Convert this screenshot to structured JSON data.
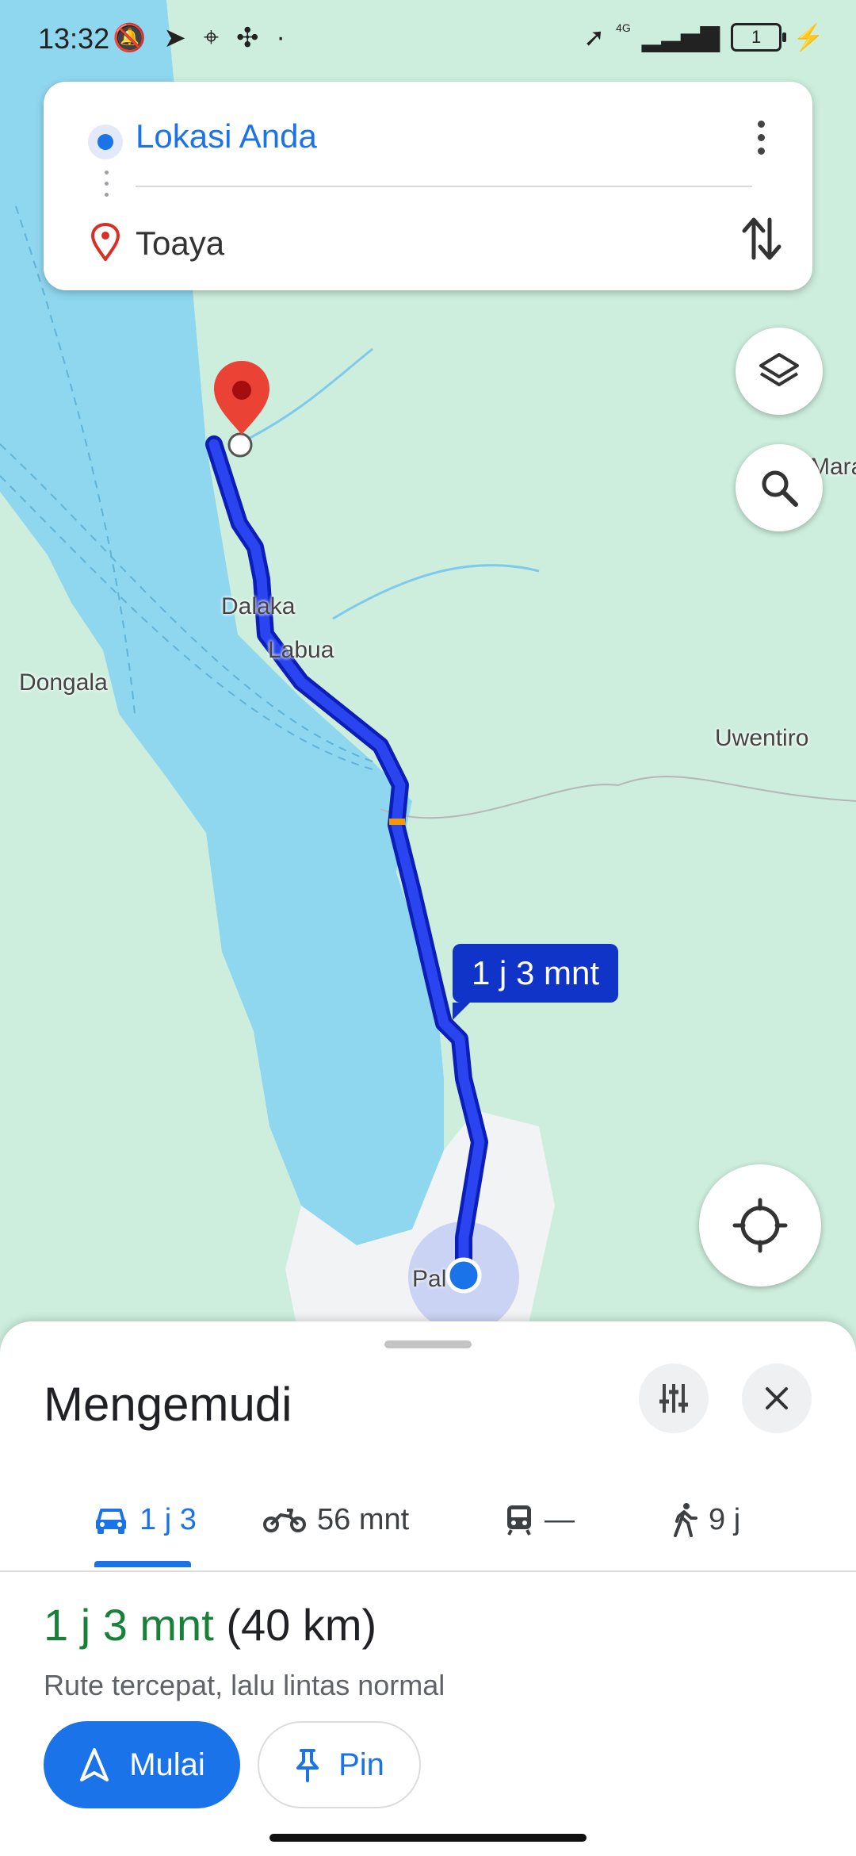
{
  "status_bar": {
    "time": "13:32",
    "network": "4G",
    "battery": "1"
  },
  "directions": {
    "origin": "Lokasi Anda",
    "destination": "Toaya"
  },
  "map": {
    "labels": {
      "mara": "Mara",
      "dalaka": "Dalaka",
      "labua": "Labua",
      "dongala": "Dongala",
      "uwentiro": "Uwentiro",
      "palu": "Pal"
    },
    "eta_bubble": "1 j 3 mnt",
    "colors": {
      "route": "#1a1aeb",
      "water": "#8fd7ef",
      "land": "#cdeedd"
    }
  },
  "sheet": {
    "title": "Mengemudi",
    "tabs": [
      {
        "icon": "car-icon",
        "label": "1 j 3"
      },
      {
        "icon": "motorcycle-icon",
        "label": "56 mnt"
      },
      {
        "icon": "transit-icon",
        "label": "—"
      },
      {
        "icon": "walking-icon",
        "label": "9 j"
      }
    ],
    "summary_duration": "1 j 3 mnt",
    "summary_distance": "(40 km)",
    "subtext": "Rute tercepat, lalu lintas normal",
    "start_label": "Mulai",
    "pin_label": "Pin"
  }
}
